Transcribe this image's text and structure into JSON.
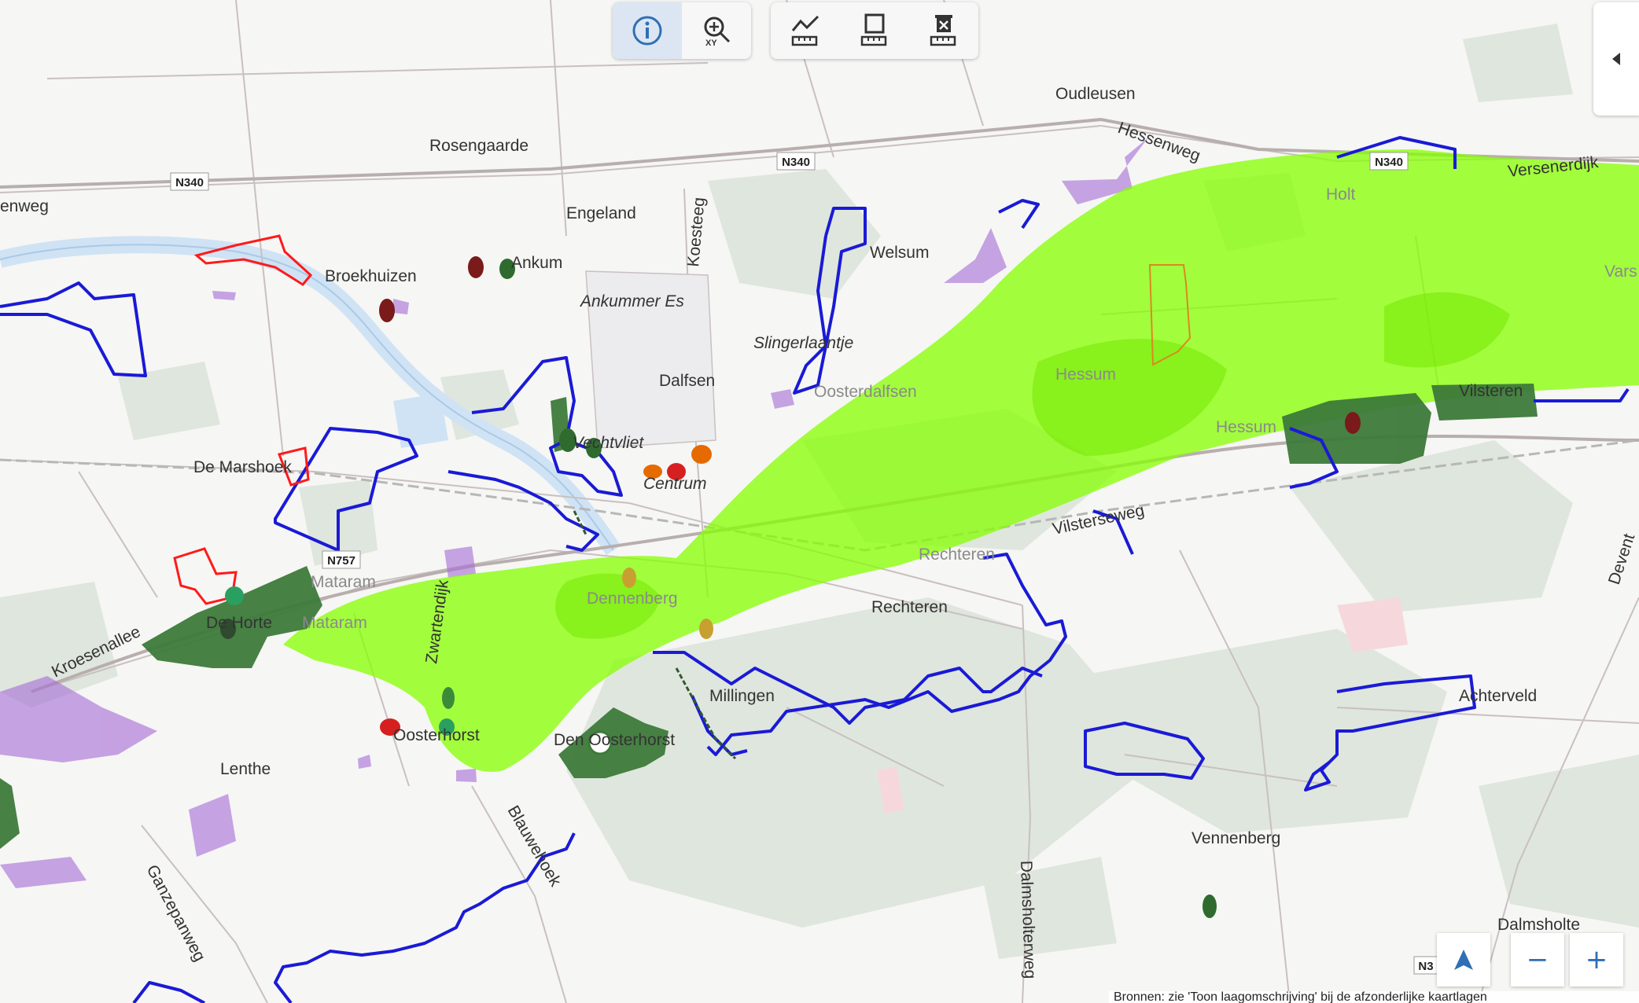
{
  "map": {
    "places": [
      {
        "name": "Oudleusen",
        "style": "normal"
      },
      {
        "name": "Rosengaarde",
        "style": "normal"
      },
      {
        "name": "Engeland",
        "style": "normal"
      },
      {
        "name": "Welsum",
        "style": "normal"
      },
      {
        "name": "Broekhuizen",
        "style": "normal"
      },
      {
        "name": "Ankummer Es",
        "style": "italic"
      },
      {
        "name": "Slingerlaantje",
        "style": "italic"
      },
      {
        "name": "Dalfsen",
        "style": "normal"
      },
      {
        "name": "Oosterdalfsen",
        "style": "faint"
      },
      {
        "name": "De Marshoek",
        "style": "normal"
      },
      {
        "name": "Vechtvliet",
        "style": "italic"
      },
      {
        "name": "Centrum",
        "style": "italic"
      },
      {
        "name": "Hessum",
        "style": "faint"
      },
      {
        "name": "Vilsteren",
        "style": "normal"
      },
      {
        "name": "Mataram",
        "style": "faint"
      },
      {
        "name": "De Horte",
        "style": "normal"
      },
      {
        "name": "Rechteren",
        "style": "normal"
      },
      {
        "name": "Millingen",
        "style": "normal"
      },
      {
        "name": "Achterveld",
        "style": "normal"
      },
      {
        "name": "Lenthe",
        "style": "normal"
      },
      {
        "name": "Den Oosterhorst",
        "style": "normal"
      },
      {
        "name": "Vennenberg",
        "style": "normal"
      },
      {
        "name": "Dalmsholte",
        "style": "normal"
      },
      {
        "name": "Holt",
        "style": "faint"
      },
      {
        "name": "Ankum",
        "style": "normal"
      },
      {
        "name": "Hessum",
        "style": "faint"
      },
      {
        "name": "Dennenberg",
        "style": "faint"
      },
      {
        "name": "Mataram",
        "style": "faint"
      },
      {
        "name": "Oosterhorst",
        "style": "normal"
      },
      {
        "name": "Vars",
        "style": "faint"
      },
      {
        "name": "Rechteren",
        "style": "faint"
      }
    ],
    "roads": [
      {
        "name": "Hessenweg"
      },
      {
        "name": "Koesteeg"
      },
      {
        "name": "Kroesenallee"
      },
      {
        "name": "Blauwehoek"
      },
      {
        "name": "Ganzepanweg"
      },
      {
        "name": "Dalmsholterweg"
      },
      {
        "name": "Devent"
      },
      {
        "name": "Vilsterseweg"
      },
      {
        "name": "Versenerdijk"
      },
      {
        "name": "Zwartendijk"
      },
      {
        "name": "enweg"
      }
    ],
    "shields": [
      "N340",
      "N340",
      "N340",
      "N757",
      "N3"
    ],
    "colors": {
      "background": "#f6f6f4",
      "forest": "#dfe6dd",
      "water": "#cfe3f5",
      "road": "#c9c0c0",
      "natura2000": "#86ff00",
      "nature_reserve": "#3d7a3a",
      "boundary_blue": "#1a1ad6",
      "boundary_red": "#ff1a1a",
      "purple_area": "#a56ad6"
    }
  },
  "toolbar": {
    "info_icon": "info-icon",
    "zoom_xy_icon": "zoom-xy-icon",
    "measure_line_icon": "measure-line-icon",
    "measure_area_icon": "measure-area-icon",
    "clear_measure_icon": "clear-measure-icon"
  },
  "controls": {
    "locate_icon": "locate-arrow-icon",
    "zoom_out_label": "−",
    "zoom_in_label": "+",
    "collapse_icon": "chevron-left-icon"
  },
  "attribution": "Bronnen: zie 'Toon laagomschrijving' bij de afzonderlijke kaartlagen"
}
